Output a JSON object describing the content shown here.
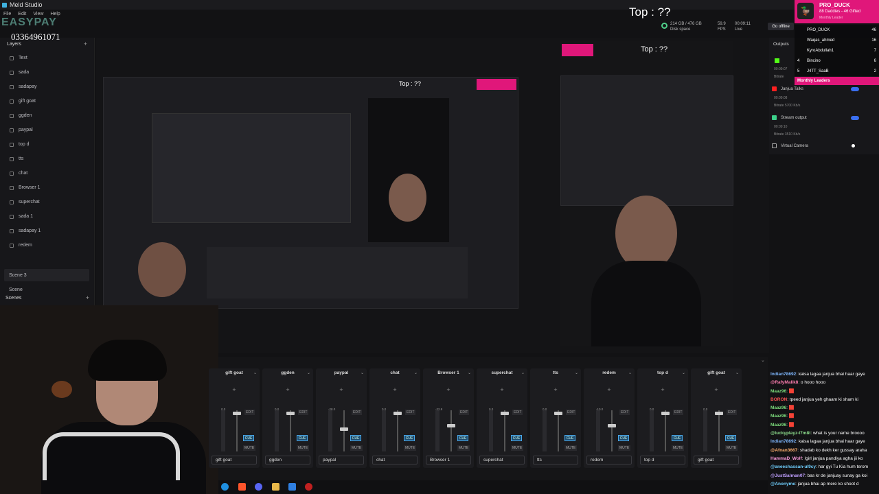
{
  "window": {
    "app_title": "Meld Studio"
  },
  "menu": [
    "File",
    "Edit",
    "View",
    "Help"
  ],
  "overlay": {
    "watermark": "EASYPAY",
    "phone": "03364961071",
    "top_text": "Top : ??"
  },
  "layers": {
    "title": "Layers",
    "items": [
      "Text",
      "sada",
      "sadapay",
      "gift goat",
      "ggden",
      "paypal",
      "top d",
      "tts",
      "chat",
      "Browser 1",
      "superchat",
      "sada 1",
      "sadapay 1",
      "redem"
    ]
  },
  "scenes": {
    "title": "Scenes",
    "items": [
      "Scene 3",
      "Scene"
    ]
  },
  "status": {
    "disk": "214 GB / 476 GB",
    "disk_label": "Disk space",
    "fps": "59.9",
    "fps_label": "FPS",
    "time": "00:09:11",
    "live_label": "Live",
    "go_offline": "Go offline"
  },
  "outputs": {
    "title": "Outputs",
    "items": [
      {
        "name": "",
        "time": "00:09:07",
        "bitrate": "Bitrate"
      },
      {
        "name": "Janjua Talks",
        "time": "00:09:08",
        "bitrate": "Bitrate 5700 Kb/s"
      },
      {
        "name": "Stream output",
        "time": "00:09:10",
        "bitrate": "Bitrate 3510 Kb/s"
      },
      {
        "name": "Virtual Camera"
      }
    ]
  },
  "leaderboard": {
    "name": "PRO_DUCK",
    "subtitle": "88 Daddies - 46 Gifted",
    "role": "Monthly Leader",
    "rows": [
      {
        "rank": "",
        "name": "PRO_DUCK",
        "score": "46"
      },
      {
        "rank": "",
        "name": "Waqas_ahmed",
        "score": "16"
      },
      {
        "rank": "",
        "name": "KyroAbdullah1",
        "score": "7"
      },
      {
        "rank": "4",
        "name": "Bincino",
        "score": "6"
      },
      {
        "rank": "5",
        "name": "J4TT_SaaB",
        "score": "2"
      }
    ],
    "footer": "Monthly Leaders"
  },
  "mixer": {
    "channels": [
      {
        "name": "gift goat",
        "db": "0.0"
      },
      {
        "name": "ggden",
        "db": "0.0"
      },
      {
        "name": "paypal",
        "db": "-28.0"
      },
      {
        "name": "chat",
        "db": "0.0"
      },
      {
        "name": "Browser 1",
        "db": "-22.8"
      },
      {
        "name": "superchat",
        "db": "0.0"
      },
      {
        "name": "tts",
        "db": "0.0"
      },
      {
        "name": "redem",
        "db": "-10.0"
      },
      {
        "name": "top d",
        "db": "0.0"
      },
      {
        "name": "gift goat",
        "db": "0.0"
      }
    ],
    "edit_label": "EDIT",
    "cue_label": "CUE",
    "mute_label": "MUTE"
  },
  "chat": [
    {
      "user": "Indian78692",
      "msg": ": kaisa lagaa janjua bhai haar gaye",
      "color": "#7fb8ff"
    },
    {
      "user": "@RafyMalik8",
      "msg": ": o hooo hooo",
      "color": "#ff7fb0"
    },
    {
      "user": "Maaz96",
      "msg": ": 🟥",
      "color": "#7cdc7c"
    },
    {
      "user": "BORON",
      "msg": ": tpeed janjua yeh ghaam ki sham ki",
      "color": "#ff5555"
    },
    {
      "user": "Maaz96",
      "msg": ": 🟥",
      "color": "#7cdc7c"
    },
    {
      "user": "Maaz96",
      "msg": ": 🟥",
      "color": "#7cdc7c"
    },
    {
      "user": "Maaz96",
      "msg": ": 🟥",
      "color": "#7cdc7c"
    },
    {
      "user": "@luckyplayz-l7m8t",
      "msg": ": what is your name broooo",
      "color": "#8fe08f"
    },
    {
      "user": "Indian78692",
      "msg": ": kaisa lagaa janjua bhai haar gaye",
      "color": "#7fb8ff"
    },
    {
      "user": "@Afnan3667",
      "msg": ": shadab ko dekh ker gussay araha",
      "color": "#ffb070"
    },
    {
      "user": "HammaD_Wolf",
      "msg": ": !girl janjua pandiya agha jii ko",
      "color": "#ff9de0"
    },
    {
      "user": "@aneeshassan-ul9cy",
      "msg": ": har gyi Tu Kia hum terom",
      "color": "#70d0ff"
    },
    {
      "user": "@JustSalman07",
      "msg": ": bas kr de janjuay sunay ga koi",
      "color": "#c0a0ff"
    },
    {
      "user": "@Anonyme",
      "msg": ": janjua bhai ap mere ko shoot d",
      "color": "#70d0ff"
    }
  ],
  "colors": {
    "accent_pink": "#e0177a",
    "cue_blue": "#4aa8e8",
    "toggle_blue": "#3a6ff0"
  }
}
